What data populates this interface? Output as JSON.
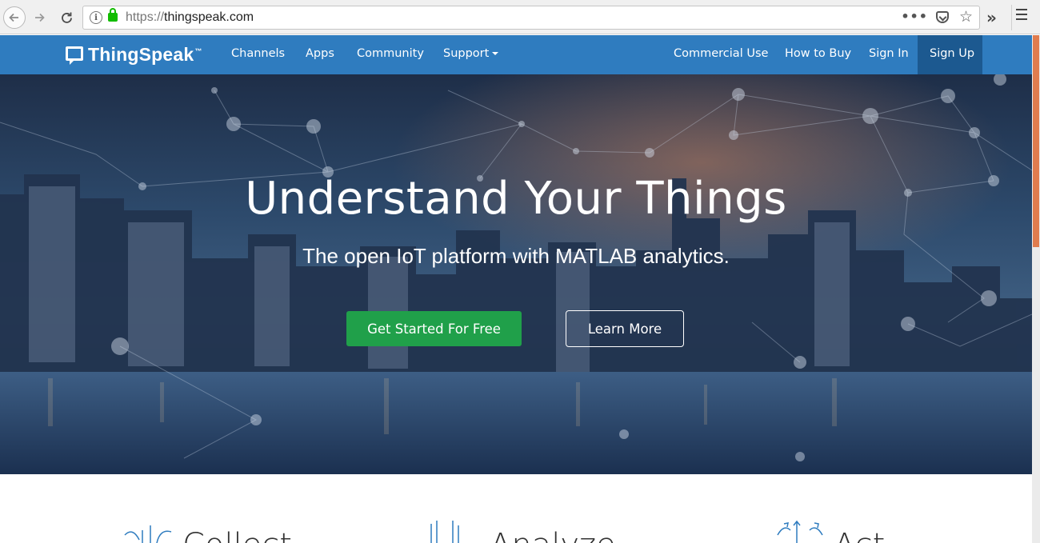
{
  "browser": {
    "url_scheme": "https://",
    "url_host": "thingspeak.com"
  },
  "nav": {
    "logo_text": "ThingSpeak",
    "logo_tm": "™",
    "links_left": [
      "Channels",
      "Apps",
      "Community",
      "Support"
    ],
    "links_right": [
      "Commercial Use",
      "How to Buy",
      "Sign In",
      "Sign Up"
    ],
    "bg_color": "#2f7cbf",
    "signup_bg_color": "#1c5990"
  },
  "hero": {
    "title": "Understand Your Things",
    "subtitle": "The open IoT platform with MATLAB analytics.",
    "primary_button": "Get Started For Free",
    "secondary_button": "Learn More",
    "primary_color": "#20a04a"
  },
  "features": {
    "headings": [
      "Collect",
      "Analyze",
      "Act"
    ],
    "icons": [
      "collect-icon",
      "analyze-icon",
      "act-icon"
    ]
  }
}
